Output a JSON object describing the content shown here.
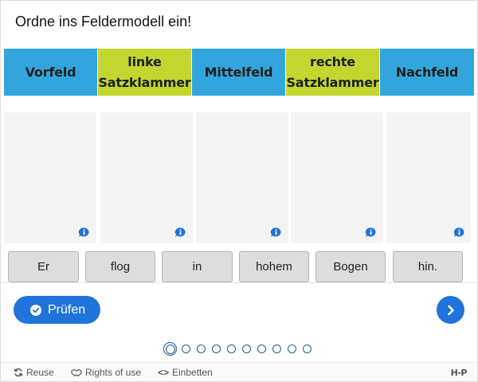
{
  "task": {
    "title": "Ordne ins Feldermodell ein!"
  },
  "header": {
    "cells": [
      {
        "line1": "Vorfeld",
        "line2": ""
      },
      {
        "line1": "linke",
        "line2": "Satzklammer"
      },
      {
        "line1": "Mittelfeld",
        "line2": ""
      },
      {
        "line1": "rechte",
        "line2": "Satzklammer"
      },
      {
        "line1": "Nachfeld",
        "line2": ""
      }
    ]
  },
  "dropzones": {
    "info_icon": "info-icon"
  },
  "words": [
    "Er",
    "flog",
    "in",
    "hohem",
    "Bogen",
    "hin."
  ],
  "actions": {
    "check_label": "Prüfen",
    "next_icon": "chevron-right-icon"
  },
  "pagination": {
    "total": 10,
    "current": 1
  },
  "footer": {
    "reuse": "Reuse",
    "rights": "Rights of use",
    "embed": "Einbetten",
    "brand": "H-P"
  },
  "colors": {
    "blue": "#32a6dc",
    "green": "#c3d62f",
    "accent": "#1f73d9"
  }
}
